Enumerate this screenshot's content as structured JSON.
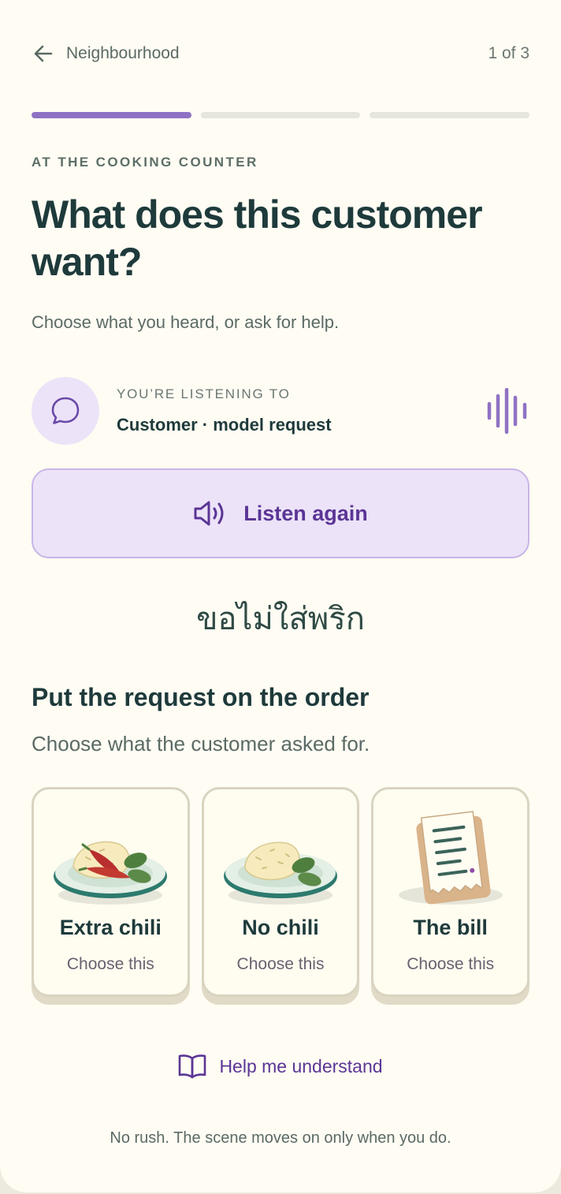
{
  "header": {
    "back_label": "Neighbourhood",
    "step_count": "1 of 3"
  },
  "progress": {
    "current_step": 1,
    "total_steps": 3
  },
  "scene": {
    "eyebrow": "AT THE COOKING COUNTER",
    "title": "What does this customer want?",
    "subtitle": "Choose what you heard, or ask for help."
  },
  "listening": {
    "label": "YOU’RE LISTENING TO",
    "speaker": "Customer · model request",
    "icon": "speech-bubble-icon",
    "wave_icon": "audio-wave-icon"
  },
  "listen_button": {
    "label": "Listen again",
    "icon": "speaker-icon"
  },
  "phrase": "ขอไม่ใส่พริก",
  "task": {
    "title": "Put the request on the order",
    "subtitle": "Choose what the customer asked for."
  },
  "options": [
    {
      "label": "Extra chili",
      "action": "Choose this",
      "icon": "rice-with-extra-chili-plate"
    },
    {
      "label": "No chili",
      "action": "Choose this",
      "icon": "rice-plate-no-chili"
    },
    {
      "label": "The bill",
      "action": "Choose this",
      "icon": "bill-receipt"
    }
  ],
  "help": {
    "label": "Help me understand",
    "icon": "open-book-icon"
  },
  "footer_note": "No rush. The scene moves on only when you do.",
  "colors": {
    "background": "#fefcf3",
    "accent_purple": "#8f72c4",
    "button_bg": "#ece3f8",
    "button_text": "#5b3596",
    "heading": "#1e3a3b",
    "muted": "#5b6a65"
  }
}
